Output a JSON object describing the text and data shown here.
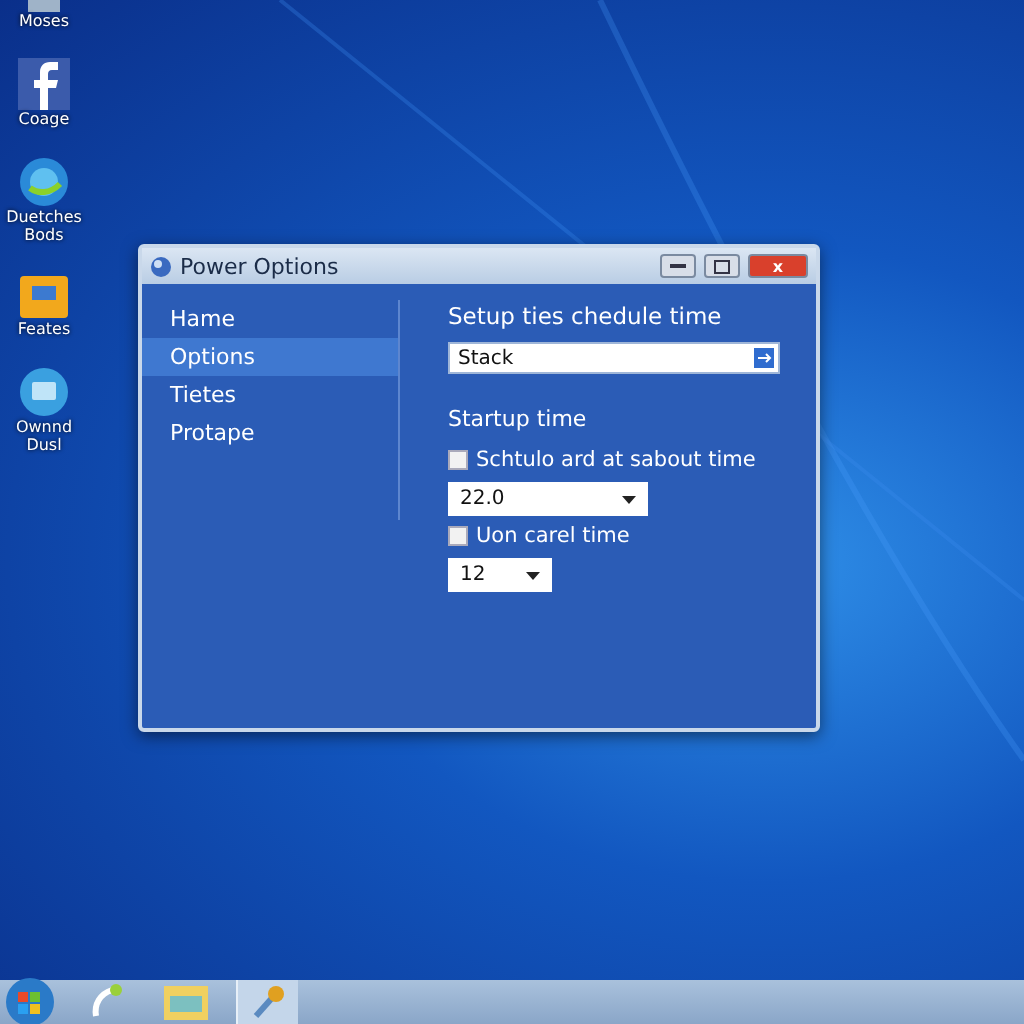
{
  "desktop_icons": [
    {
      "label": "Moses",
      "kind": "cut"
    },
    {
      "label": "Coage",
      "kind": "social"
    },
    {
      "label": "Duetches Bods",
      "kind": "browser"
    },
    {
      "label": "Feates",
      "kind": "folder"
    },
    {
      "label": "Ownnd Dusl",
      "kind": "media"
    }
  ],
  "window": {
    "title": "Power Options",
    "close": "x"
  },
  "sidebar": {
    "items": [
      {
        "label": "Hame",
        "selected": false
      },
      {
        "label": "Options",
        "selected": true
      },
      {
        "label": "Tietes",
        "selected": false
      },
      {
        "label": "Protape",
        "selected": false
      }
    ]
  },
  "content": {
    "heading": "Setup ties chedule time",
    "field": {
      "value": "Stack"
    },
    "section": "Startup time",
    "options": [
      {
        "label": "Schtulo ard at sabout time",
        "checked": false,
        "dropdown": "22.0",
        "wide": true
      },
      {
        "label": "Uon carel time",
        "checked": false,
        "dropdown": "12",
        "wide": false
      }
    ]
  },
  "taskbar": {
    "items": [
      {
        "kind": "phone",
        "selected": false
      },
      {
        "kind": "folder",
        "selected": false
      },
      {
        "kind": "tool",
        "selected": true
      }
    ]
  }
}
